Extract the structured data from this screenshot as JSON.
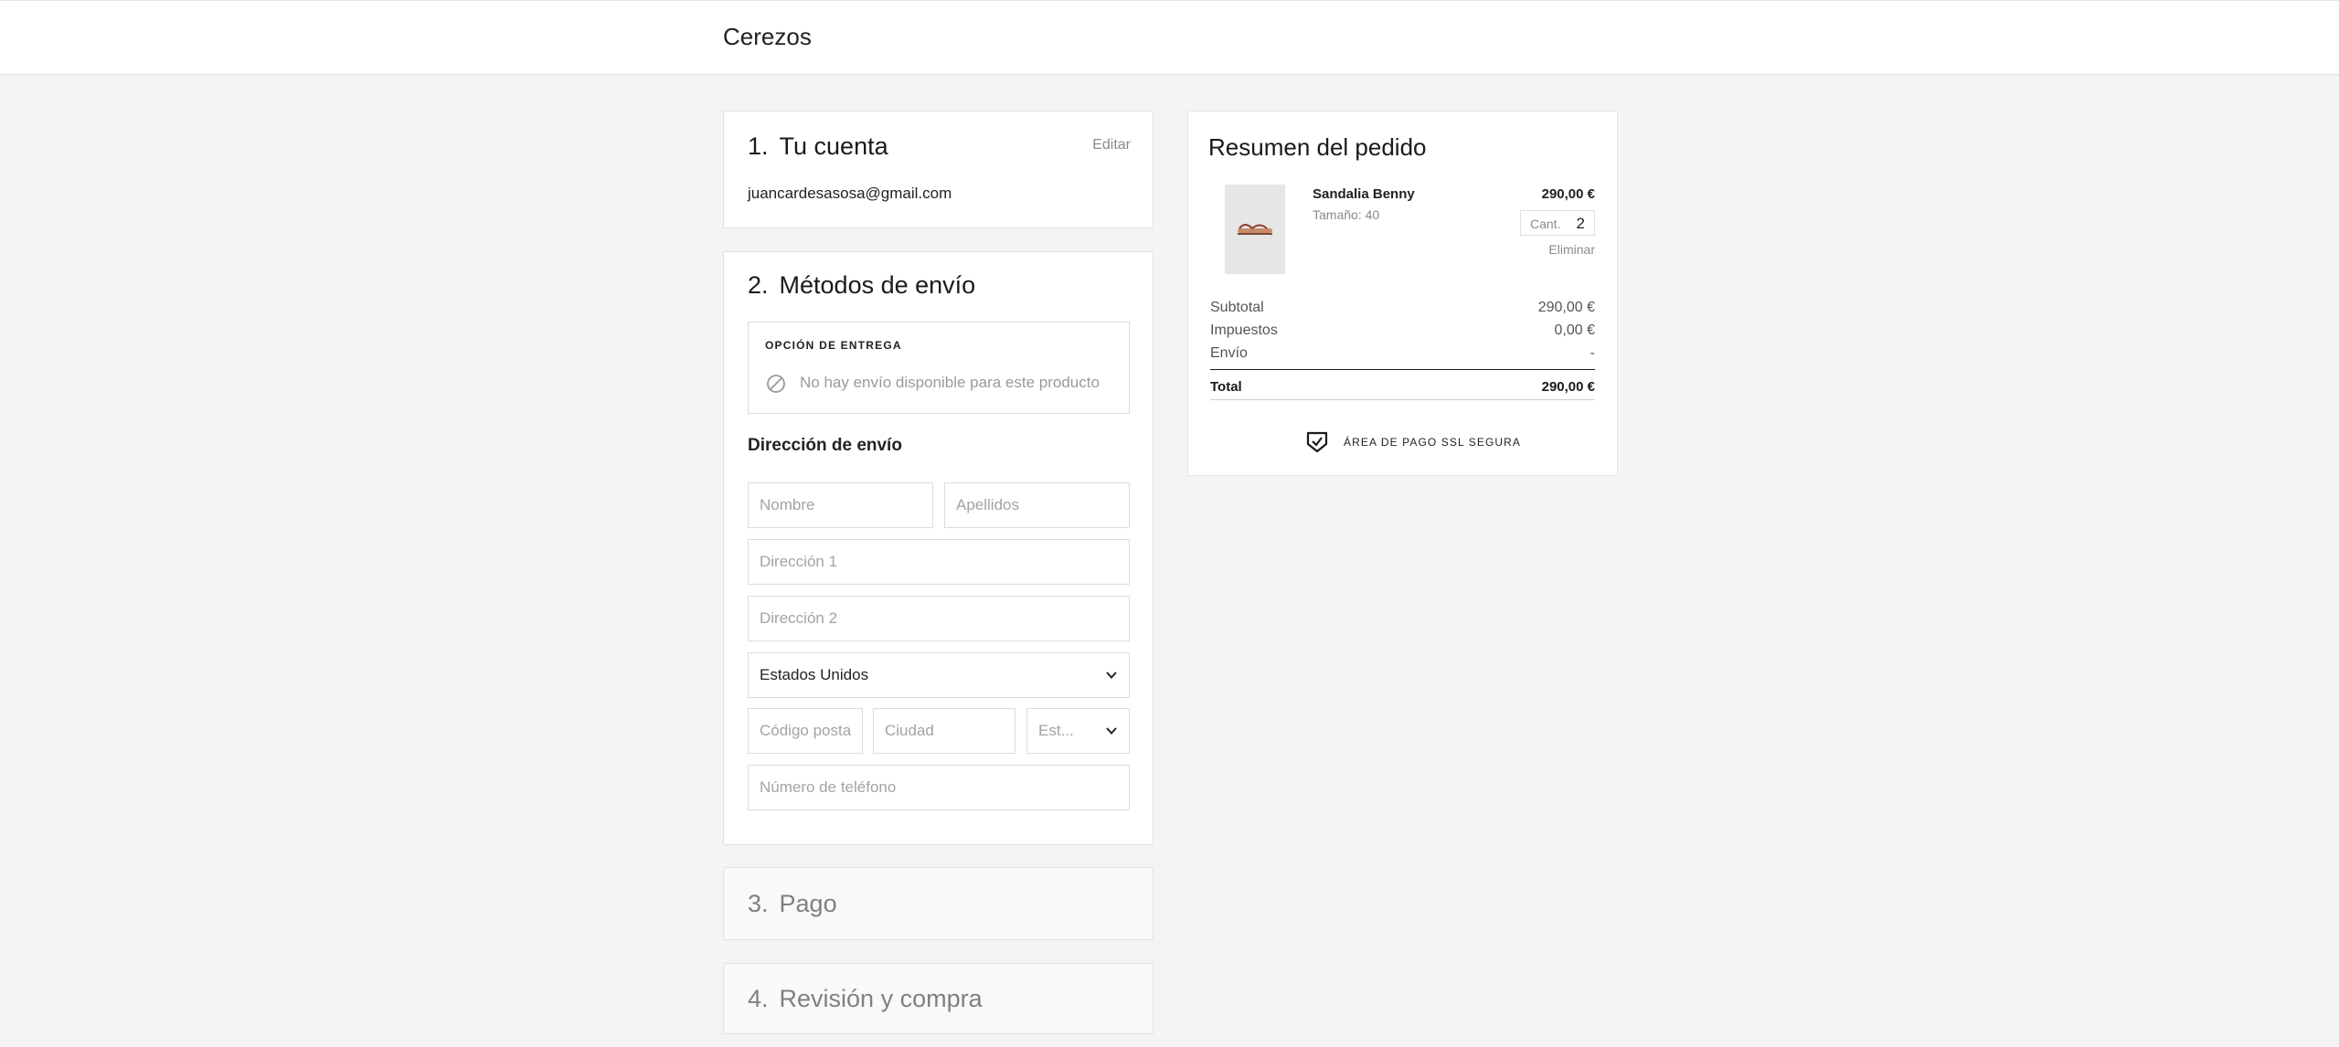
{
  "header": {
    "brand": "Cerezos"
  },
  "account": {
    "number": "1.",
    "title": "Tu cuenta",
    "edit_label": "Editar",
    "email": "juancardesasosa@gmail.com"
  },
  "shipping": {
    "number": "2.",
    "title": "Métodos de envío",
    "delivery_heading": "OPCIÓN DE ENTREGA",
    "no_shipping_text": "No hay envío disponible para este producto",
    "address_heading": "Dirección de envío",
    "fields": {
      "first_name": {
        "placeholder": "Nombre"
      },
      "last_name": {
        "placeholder": "Apellidos"
      },
      "address1": {
        "placeholder": "Dirección 1"
      },
      "address2": {
        "placeholder": "Dirección 2"
      },
      "country": {
        "value": "Estados Unidos"
      },
      "postal_code": {
        "placeholder": "Código postal"
      },
      "city": {
        "placeholder": "Ciudad"
      },
      "state": {
        "placeholder": "Est..."
      },
      "phone": {
        "placeholder": "Número de teléfono"
      }
    }
  },
  "payment": {
    "number": "3.",
    "title": "Pago"
  },
  "review": {
    "number": "4.",
    "title": "Revisión y compra"
  },
  "summary": {
    "title": "Resumen del pedido",
    "item": {
      "name": "Sandalia Benny",
      "size": "Tamaño: 40",
      "price": "290,00 €",
      "qty_label": "Cant.",
      "qty": "2",
      "remove_label": "Eliminar"
    },
    "subtotal_label": "Subtotal",
    "subtotal_value": "290,00 €",
    "tax_label": "Impuestos",
    "tax_value": "0,00 €",
    "shipping_label": "Envío",
    "shipping_value": "-",
    "total_label": "Total",
    "total_value": "290,00 €",
    "ssl_text": "ÁREA DE PAGO SSL SEGURA"
  },
  "colors": {
    "background": "#f4f4f4",
    "card": "#ffffff",
    "border": "#dcdcdc",
    "muted_text": "#8a8a8a"
  }
}
